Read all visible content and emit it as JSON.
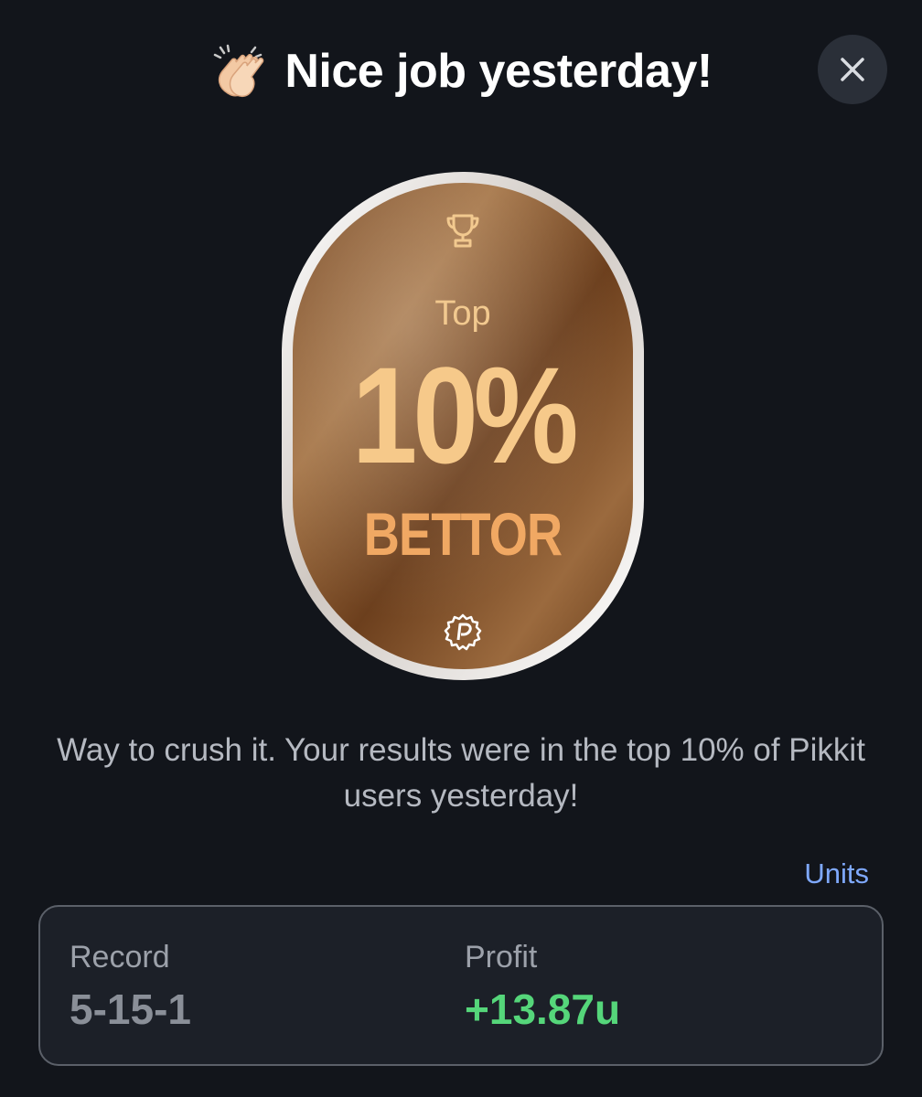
{
  "header": {
    "title": "Nice job yesterday!",
    "emoji_icon": "clapping-hands-icon",
    "close_icon": "close-icon"
  },
  "badge": {
    "icon_top": "trophy-icon",
    "line1": "Top",
    "percent": "10%",
    "line3": "BETTOR",
    "icon_bottom": "pikkit-logo-icon",
    "colors": {
      "bronze_dark": "#6a3f1c",
      "bronze_light": "#b07a4a",
      "text_gold": "#f6c98a",
      "rim": "#e9e4df"
    }
  },
  "message": "Way to crush it. Your results were in the top 10% of Pikkit users yesterday!",
  "units_link": "Units",
  "stats": {
    "record_label": "Record",
    "record_value": "5-15-1",
    "profit_label": "Profit",
    "profit_value": "+13.87u",
    "profit_color": "#55d67a"
  }
}
